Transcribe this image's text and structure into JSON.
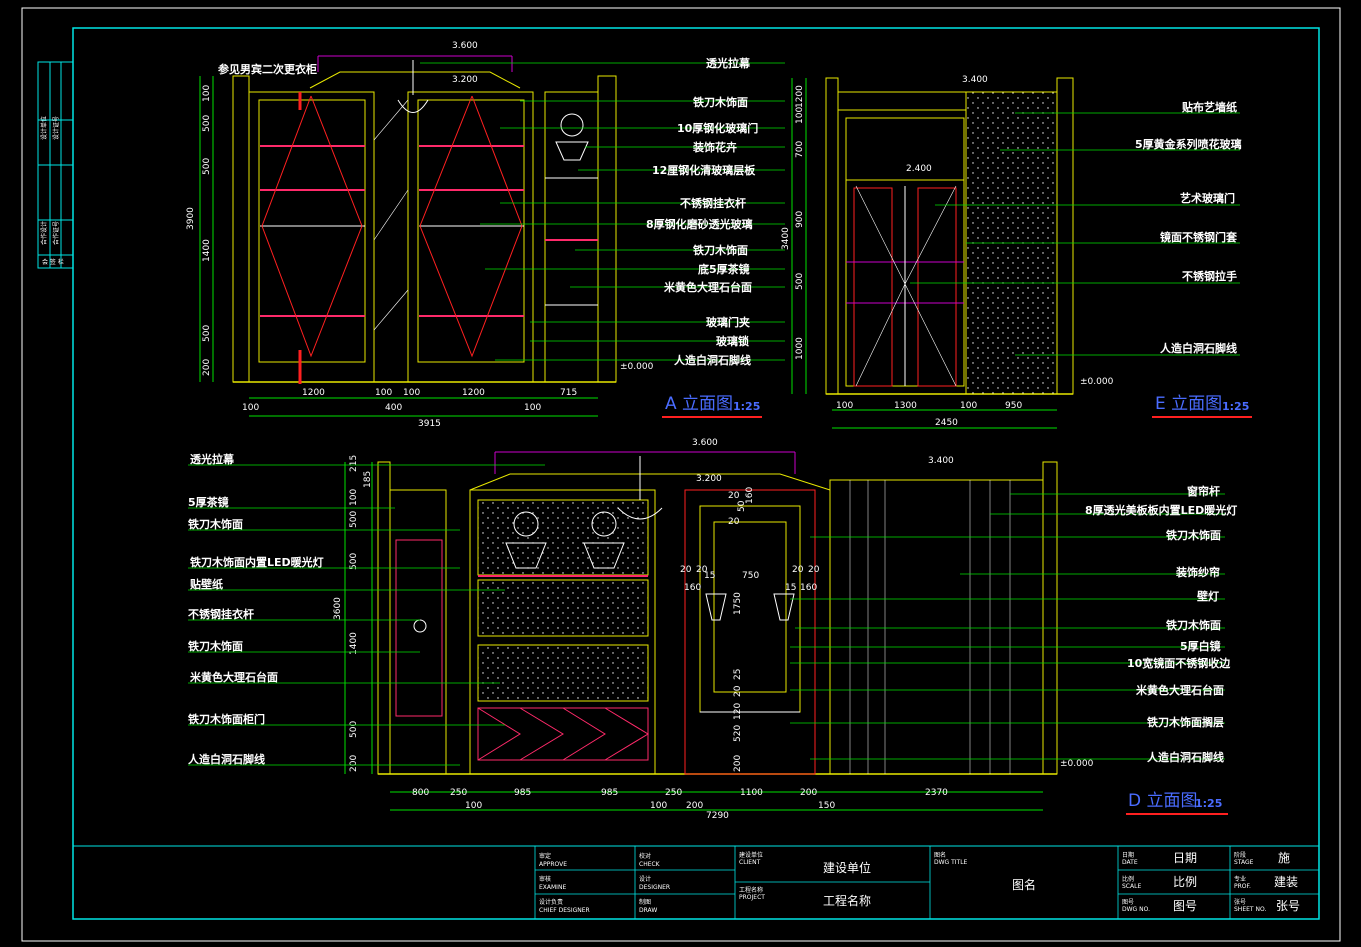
{
  "elevations": {
    "A": {
      "title": "A 立面图",
      "scale": "1:25",
      "top_dims": [
        "3.600",
        "3.200"
      ],
      "note": "参见男宾二次更衣柜",
      "callouts": [
        "透光拉幕",
        "铁刀木饰面",
        "10厚钢化玻璃门",
        "装饰花卉",
        "12厘钢化清玻璃层板",
        "不锈钢挂衣杆",
        "8厚钢化磨砂透光玻璃",
        "铁刀木饰面",
        "底5厚茶镜",
        "米黄色大理石台面",
        "玻璃门夹",
        "玻璃锁",
        "人造白洞石脚线"
      ],
      "left_dims": [
        "100",
        "500",
        "500",
        "1400",
        "500",
        "200"
      ],
      "total_height": "3900",
      "bottom_dims": [
        "1200",
        "100",
        "100",
        "1200",
        "715"
      ],
      "bottom_dims2": [
        "100",
        "400",
        "100"
      ],
      "total_width": "3915",
      "level": "±0.000"
    },
    "E": {
      "title": "E 立面图",
      "scale": "1:25",
      "top_dim": "3.400",
      "inner_dim": "2.400",
      "callouts": [
        "贴布艺墙纸",
        "5厚黄金系列喷花玻璃",
        "艺术玻璃门",
        "镜面不锈钢门套",
        "不锈钢拉手",
        "人造白洞石脚线"
      ],
      "left_dims": [
        "1200",
        "100",
        "700",
        "900",
        "500",
        "1000"
      ],
      "total_height": "3400",
      "bottom_dims": [
        "100",
        "1300",
        "100",
        "950"
      ],
      "total_width": "2450",
      "level": "±0.000"
    },
    "D": {
      "title": "D 立面图",
      "scale": "1:25",
      "top_dims": [
        "3.600",
        "3.200",
        "3.400"
      ],
      "left_callouts": [
        "透光拉幕",
        "5厚茶镜",
        "铁刀木饰面",
        "铁刀木饰面内置LED暖光灯",
        "贴壁纸",
        "不锈钢挂衣杆",
        "铁刀木饰面",
        "米黄色大理石台面",
        "铁刀木饰面柜门",
        "人造白洞石脚线"
      ],
      "right_callouts": [
        "窗帘杆",
        "8厚透光美板板内置LED暖光灯",
        "铁刀木饰面",
        "装饰纱帘",
        "壁灯",
        "铁刀木饰面",
        "5厚白镜",
        "10宽镜面不锈钢收边",
        "米黄色大理石台面",
        "铁刀木饰面搁层",
        "人造白洞石脚线"
      ],
      "left_dims": [
        "215",
        "185",
        "100",
        "500",
        "500",
        "1400",
        "500",
        "200"
      ],
      "total_height": "3600",
      "mirror_dims": [
        "20",
        "20",
        "50",
        "160",
        "20",
        "20",
        "20",
        "20",
        "160",
        "15",
        "750",
        "15",
        "160",
        "1750",
        "25",
        "20",
        "120",
        "520",
        "200"
      ],
      "bottom_dims": [
        "800",
        "250",
        "985",
        "985",
        "250",
        "1100",
        "200",
        "2370"
      ],
      "bottom_dims2": [
        "100",
        "100",
        "200",
        "150"
      ],
      "total_width": "7290",
      "level": "±0.000"
    }
  },
  "sidebar": {
    "labels": [
      "设计单位",
      "设计证号",
      "合作设计",
      "合作证号",
      "会 签 栏"
    ]
  },
  "title_block": {
    "approve_cn": "审定",
    "approve_en": "APPROVE",
    "examine_cn": "审核",
    "examine_en": "EXAMINE",
    "chief_cn": "设计负责",
    "chief_en": "CHIEF DESIGNER",
    "check_cn": "校对",
    "check_en": "CHECK",
    "designer_cn": "设计",
    "designer_en": "DESIGNER",
    "draw_cn": "制图",
    "draw_en": "DRAW",
    "client_label": "建设单位",
    "client_en": "CLIENT",
    "client_value": "建设单位",
    "project_label": "工程名称",
    "project_en": "PROJECT",
    "project_value": "工程名称",
    "dwg_title_label": "图名",
    "dwg_title_en": "DWG TITLE",
    "dwg_title_value": "图名",
    "date_label": "日期",
    "date_en": "DATE",
    "date_value": "日期",
    "scale_label": "比例",
    "scale_en": "SCALE",
    "scale_value": "比例",
    "dwgno_label": "图号",
    "dwgno_en": "DWG NO.",
    "dwgno_value": "图号",
    "stage_label": "阶段",
    "stage_en": "STAGE",
    "stage_value": "施",
    "prof_label": "专业",
    "prof_en": "PROF.",
    "prof_value": "建装",
    "sheet_label": "张号",
    "sheet_en": "SHEET NO.",
    "sheet_value": "张号"
  },
  "colors": {
    "frame": "#00e5e5",
    "wall": "#e8e800",
    "dimension": "#00e000",
    "accent": "#ff2a6a",
    "red": "#ff2020",
    "magenta": "#cc00cc",
    "title": "#4a6cff",
    "underline": "#ff2020"
  }
}
